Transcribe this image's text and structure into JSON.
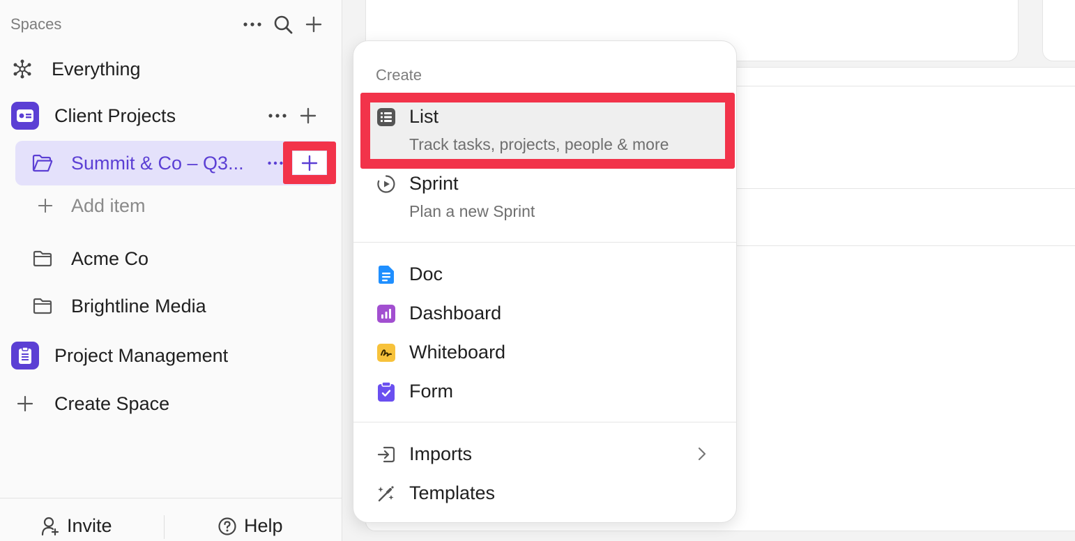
{
  "sidebar": {
    "spaces_title": "Spaces",
    "items": {
      "everything": "Everything",
      "client_projects": "Client Projects",
      "summit": "Summit & Co – Q3...",
      "add_item": "Add item",
      "acme": "Acme Co",
      "brightline": "Brightline Media",
      "project_management": "Project Management",
      "create_space": "Create Space"
    },
    "footer": {
      "invite": "Invite",
      "help": "Help"
    }
  },
  "menu": {
    "title": "Create",
    "list": {
      "label": "List",
      "sub": "Track tasks, projects, people & more"
    },
    "sprint": {
      "label": "Sprint",
      "sub": "Plan a new Sprint"
    },
    "doc": "Doc",
    "dashboard": "Dashboard",
    "whiteboard": "Whiteboard",
    "form": "Form",
    "imports": "Imports",
    "templates": "Templates"
  },
  "colors": {
    "accent": "#5b3fd4",
    "highlight": "#f2334a",
    "doc": "#1f8fff",
    "dashboard": "#a24fd0",
    "whiteboard": "#f7c23b",
    "form": "#6a4ff0"
  },
  "icons": [
    "more-icon",
    "search-icon",
    "plus-icon",
    "everything-icon",
    "space-icon",
    "folder-icon",
    "list-icon",
    "sprint-icon",
    "doc-icon",
    "dashboard-icon",
    "whiteboard-icon",
    "form-icon",
    "imports-icon",
    "templates-icon",
    "chevron-right-icon",
    "invite-icon",
    "help-icon"
  ]
}
